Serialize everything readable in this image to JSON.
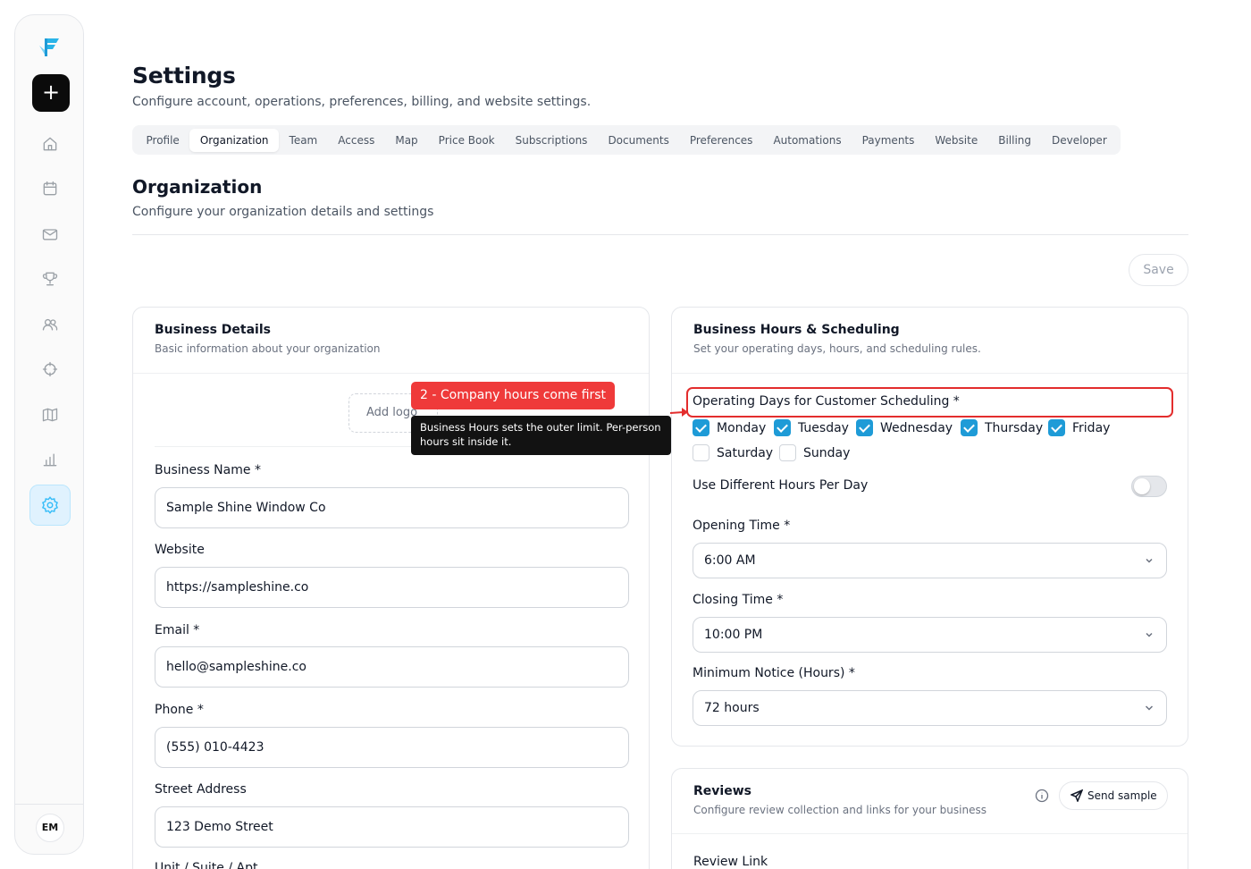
{
  "sidebar": {
    "logo_icon": "brand-logo-icon",
    "add_icon": "plus-icon",
    "add_label": "+",
    "items": [
      {
        "icon": "home-icon"
      },
      {
        "icon": "calendar-icon"
      },
      {
        "icon": "mail-icon"
      },
      {
        "icon": "trophy-icon"
      },
      {
        "icon": "users-icon"
      },
      {
        "icon": "crosshair-icon"
      },
      {
        "icon": "map-icon"
      },
      {
        "icon": "bar-chart-icon"
      },
      {
        "icon": "gear-icon",
        "active": true
      }
    ],
    "avatar_initials": "EM"
  },
  "header": {
    "title": "Settings",
    "subtitle": "Configure account, operations, preferences, billing, and website settings."
  },
  "tabs": [
    {
      "label": "Profile"
    },
    {
      "label": "Organization",
      "active": true
    },
    {
      "label": "Team"
    },
    {
      "label": "Access"
    },
    {
      "label": "Map"
    },
    {
      "label": "Price Book"
    },
    {
      "label": "Subscriptions"
    },
    {
      "label": "Documents"
    },
    {
      "label": "Preferences"
    },
    {
      "label": "Automations"
    },
    {
      "label": "Payments"
    },
    {
      "label": "Website"
    },
    {
      "label": "Billing"
    },
    {
      "label": "Developer"
    }
  ],
  "section": {
    "title": "Organization",
    "subtitle": "Configure your organization details and settings",
    "save_label": "Save"
  },
  "business_details": {
    "title": "Business Details",
    "subtitle": "Basic information about your organization",
    "add_logo_label": "Add logo",
    "fields": [
      {
        "label": "Business Name *",
        "value": "Sample Shine Window Co"
      },
      {
        "label": "Website",
        "value": "https://sampleshine.co"
      },
      {
        "label": "Email *",
        "value": "hello@sampleshine.co"
      },
      {
        "label": "Phone *",
        "value": "(555) 010-4423"
      },
      {
        "label": "Street Address",
        "value": "123 Demo Street"
      },
      {
        "label": "Unit / Suite / Apt"
      }
    ]
  },
  "scheduling": {
    "title": "Business Hours & Scheduling",
    "subtitle": "Set your operating days, hours, and scheduling rules.",
    "operating_days_label": "Operating Days for Customer Scheduling *",
    "days": [
      {
        "label": "Monday",
        "checked": true
      },
      {
        "label": "Tuesday",
        "checked": true
      },
      {
        "label": "Wednesday",
        "checked": true
      },
      {
        "label": "Thursday",
        "checked": true
      },
      {
        "label": "Friday",
        "checked": true
      },
      {
        "label": "Saturday",
        "checked": false
      },
      {
        "label": "Sunday",
        "checked": false
      }
    ],
    "different_hours_label": "Use Different Hours Per Day",
    "different_hours_on": false,
    "opening_label": "Opening Time *",
    "opening_value": "6:00 AM",
    "closing_label": "Closing Time *",
    "closing_value": "10:00 PM",
    "notice_label": "Minimum Notice (Hours) *",
    "notice_value": "72 hours"
  },
  "annotation": {
    "badge": "2 - Company hours come first",
    "tooltip": "Business Hours sets the outer limit. Per-person hours sit inside it.",
    "badge_color": "#ef3a3a",
    "highlight_color": "#e32d2d"
  },
  "reviews": {
    "title": "Reviews",
    "subtitle": "Configure review collection and links for your business",
    "send_sample_label": "Send sample",
    "review_link_label": "Review Link"
  },
  "colors": {
    "accent": "#1e9bd7",
    "active_nav_bg": "#e0f2fe",
    "active_nav_icon": "#38bdf8"
  }
}
